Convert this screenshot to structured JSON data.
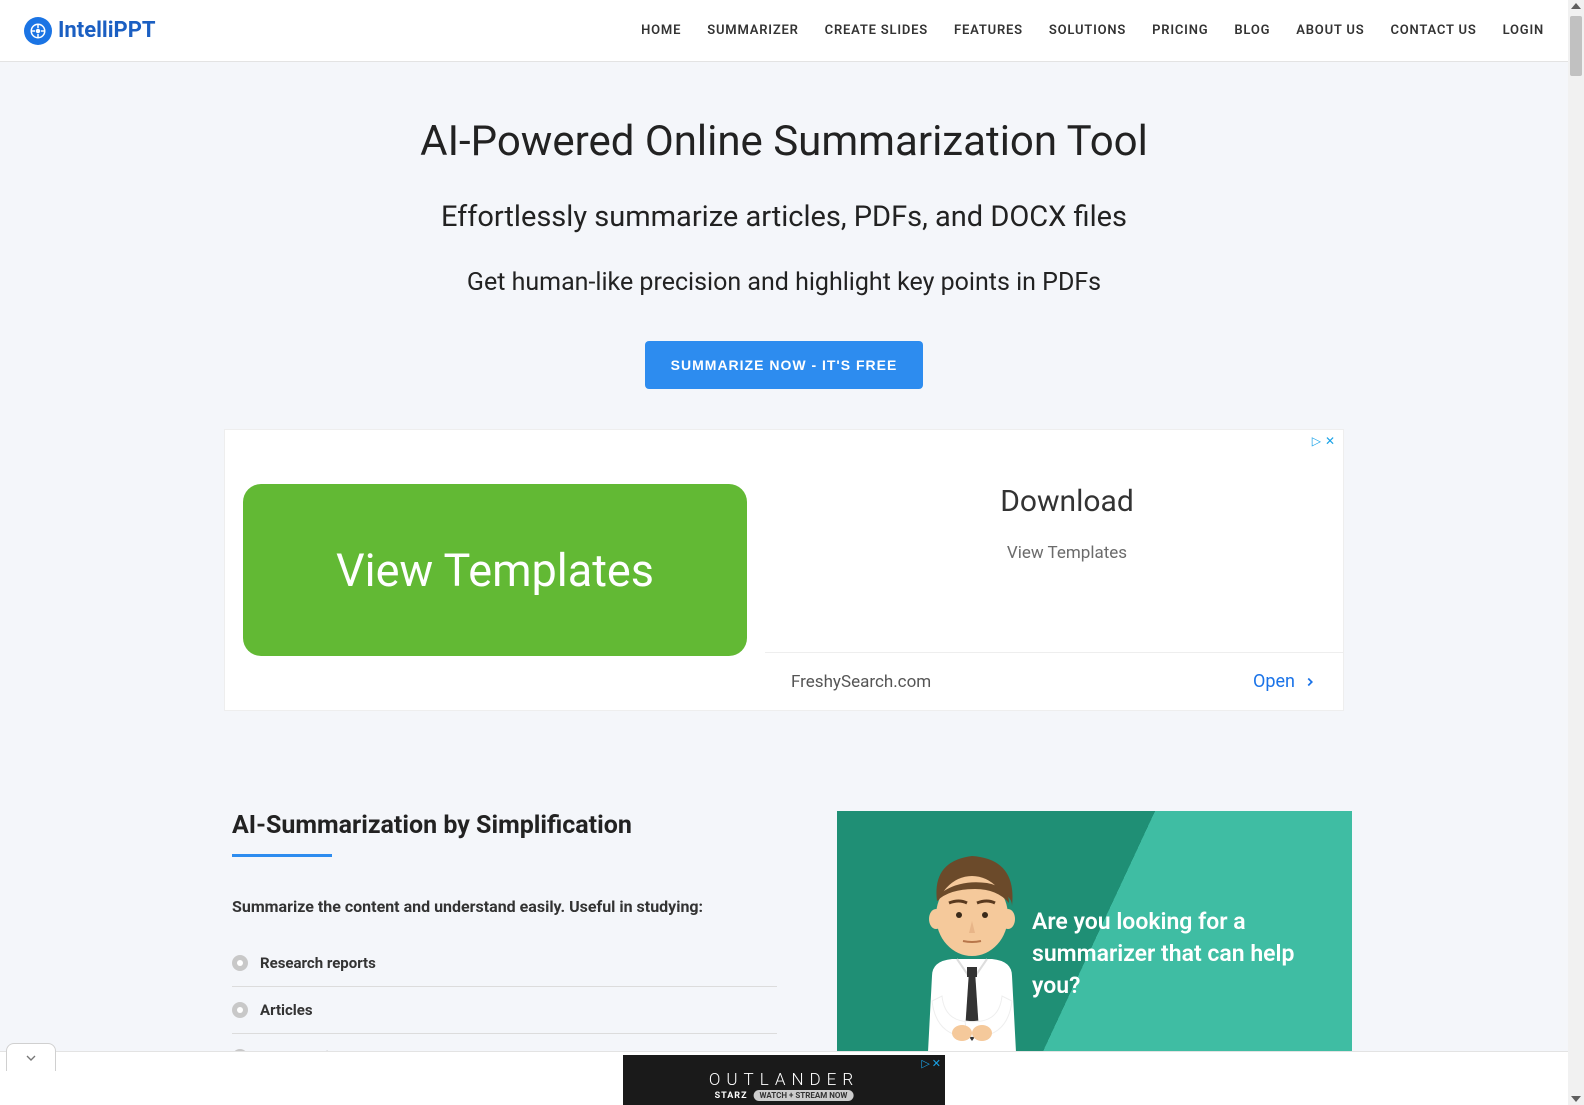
{
  "brand": {
    "name": "IntelliPPT"
  },
  "nav": {
    "items": [
      "HOME",
      "SUMMARIZER",
      "CREATE SLIDES",
      "FEATURES",
      "SOLUTIONS",
      "PRICING",
      "BLOG",
      "ABOUT US",
      "CONTACT US",
      "LOGIN"
    ]
  },
  "hero": {
    "h1": "AI-Powered Online Summarization Tool",
    "h2": "Effortlessly summarize articles, PDFs, and DOCX files",
    "h3": "Get human-like precision and highlight key points in PDFs",
    "cta": "SUMMARIZE NOW - IT'S FREE"
  },
  "ad": {
    "left_button": "View Templates",
    "title": "Download",
    "subtitle": "View Templates",
    "domain": "FreshySearch.com",
    "open": "Open"
  },
  "section": {
    "title": "AI-Summarization by Simplification",
    "intro": "Summarize the content and understand easily. Useful in studying:",
    "items": [
      "Research reports",
      "Articles",
      "Work/professional emails"
    ]
  },
  "promo": {
    "text": "Are you looking for a summarizer that can help you?"
  },
  "bottom_ad": {
    "title": "OUTLANDER",
    "brand": "STARZ",
    "watch": "WATCH + STREAM NOW"
  }
}
